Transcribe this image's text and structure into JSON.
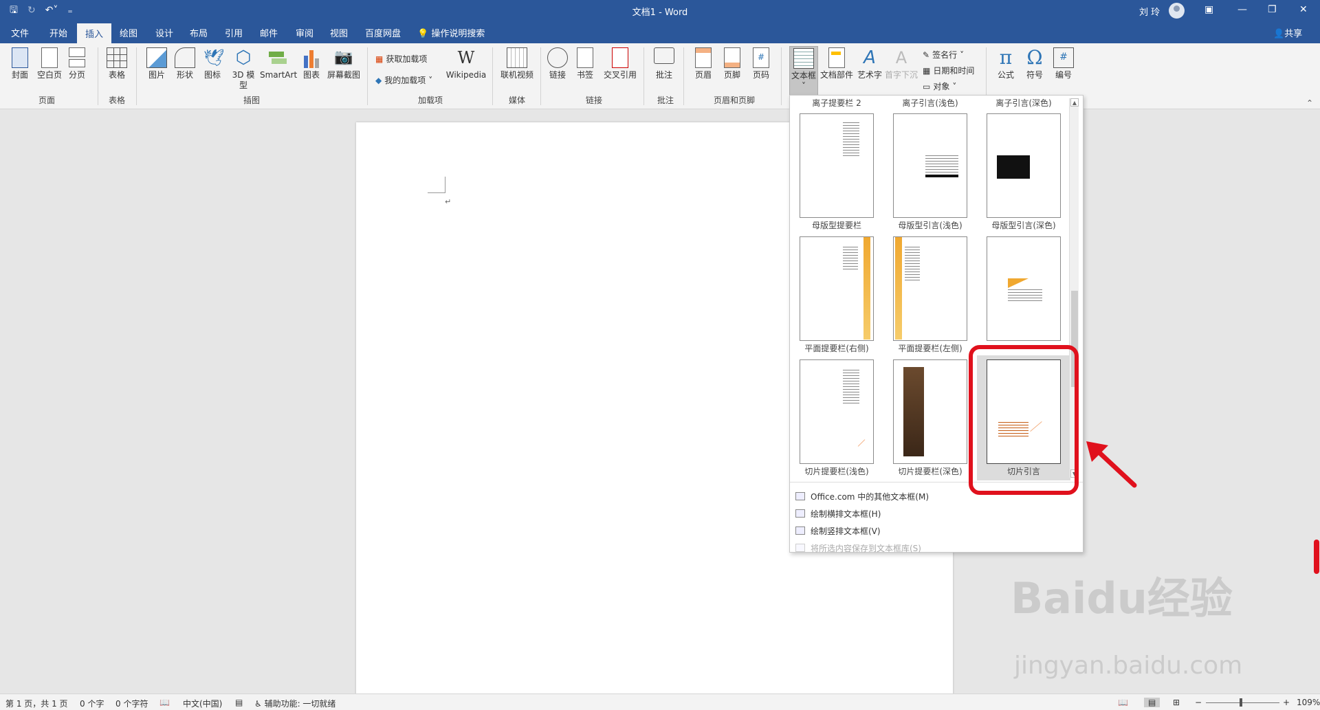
{
  "titlebar": {
    "doc_title": "文档1 - Word",
    "user_name": "刘 玲",
    "qat_icons": [
      "save-icon",
      "autosave-icon",
      "undo-icon",
      "customize-qat-icon"
    ],
    "window_controls": [
      "ribbon-display-icon",
      "minimize-icon",
      "restore-icon",
      "close-icon"
    ]
  },
  "tabs": [
    "文件",
    "开始",
    "插入",
    "绘图",
    "设计",
    "布局",
    "引用",
    "邮件",
    "审阅",
    "视图",
    "百度网盘"
  ],
  "active_tab": "插入",
  "tell_me": "操作说明搜索",
  "share": "共享",
  "ribbon": {
    "groups": {
      "pages": "页面",
      "tables": "表格",
      "illustrations": "插图",
      "addins": "加载项",
      "media": "媒体",
      "links": "链接",
      "comments": "批注",
      "header_footer": "页眉和页脚"
    },
    "buttons": {
      "cover": "封面",
      "blank": "空白页",
      "pagebreak": "分页",
      "table": "表格",
      "picture": "图片",
      "shapes": "形状",
      "icons": "图标",
      "model3d": "3D 模型",
      "smartart": "SmartArt",
      "chart": "图表",
      "screenshot": "屏幕截图",
      "get_addins": "获取加载项",
      "my_addins": "我的加载项",
      "wikipedia": "Wikipedia",
      "online_video": "联机视频",
      "link": "链接",
      "bookmark": "书签",
      "crossref": "交叉引用",
      "comment": "批注",
      "header": "页眉",
      "footer": "页脚",
      "pagenum": "页码",
      "textbox": "文本框",
      "quickparts": "文档部件",
      "wordart": "艺术字",
      "dropcap": "首字下沉",
      "signature": "签名行",
      "datetime": "日期和时间",
      "object": "对象",
      "equation": "公式",
      "symbol": "符号",
      "number": "编号"
    }
  },
  "gallery": {
    "top_captions": [
      "离子提要栏 2",
      "离子引言(浅色)",
      "离子引言(深色)"
    ],
    "rows": [
      [
        "母版型提要栏",
        "母版型引言(浅色)",
        "母版型引言(深色)"
      ],
      [
        "平面提要栏(右侧)",
        "平面提要栏(左侧)",
        ""
      ],
      [
        "切片提要栏(浅色)",
        "切片提要栏(深色)",
        "切片引言"
      ]
    ],
    "menu": [
      {
        "label": "Office.com 中的其他文本框(M)",
        "enabled": true
      },
      {
        "label": "绘制横排文本框(H)",
        "enabled": true
      },
      {
        "label": "绘制竖排文本框(V)",
        "enabled": true
      },
      {
        "label": "将所选内容保存到文本框库(S)",
        "enabled": false
      }
    ]
  },
  "document": {
    "paragraph_mark": "↵"
  },
  "status": {
    "page": "第 1 页，共 1 页",
    "words": "0 个字",
    "chars": "0 个字符",
    "lang": "中文(中国)",
    "accessibility": "辅助功能: 一切就绪",
    "zoom": "109%",
    "zoom_minus": "−",
    "zoom_plus": "+"
  },
  "watermark": {
    "brand": "Baidu经验",
    "url": "jingyan.baidu.com"
  },
  "colors": {
    "accent": "#2b579a",
    "highlight": "#e0111d"
  }
}
